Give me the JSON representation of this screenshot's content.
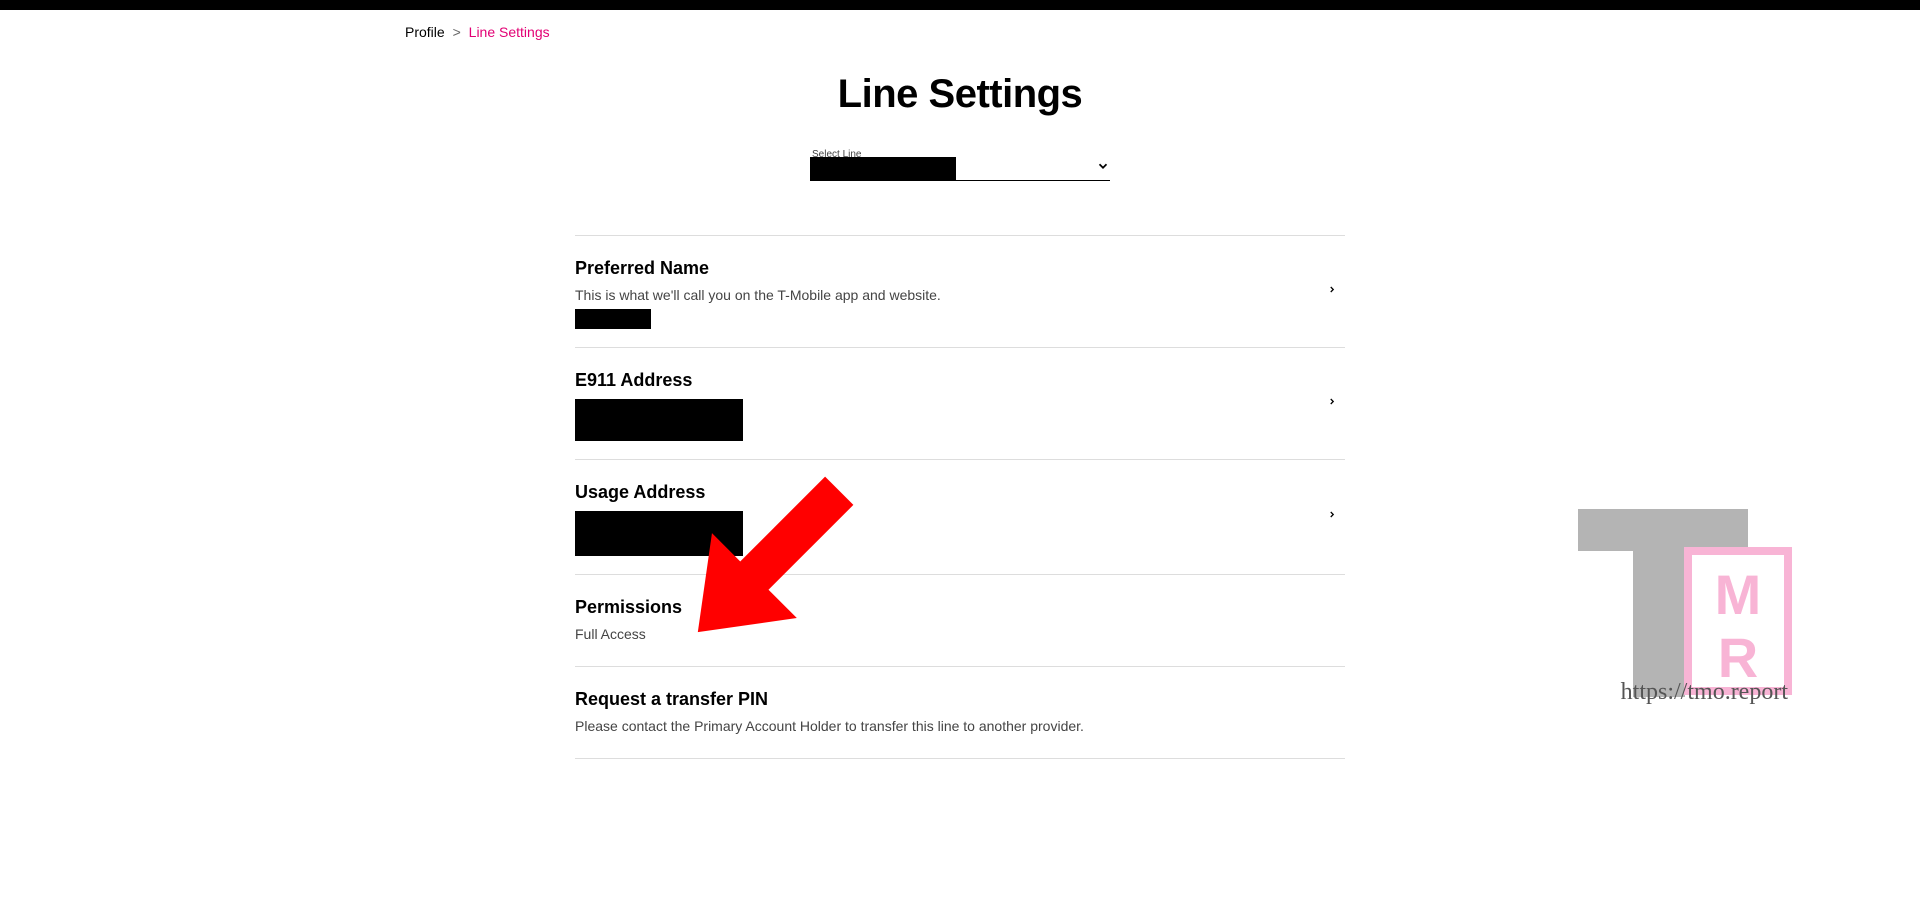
{
  "breadcrumb": {
    "root": "Profile",
    "current": "Line Settings"
  },
  "page_title": "Line Settings",
  "line_selector": {
    "label": "Select Line"
  },
  "rows": {
    "preferred_name": {
      "title": "Preferred Name",
      "desc": "This is what we'll call you on the T-Mobile app and website."
    },
    "e911": {
      "title": "E911 Address"
    },
    "usage": {
      "title": "Usage Address"
    },
    "permissions": {
      "title": "Permissions",
      "value": "Full Access"
    },
    "transfer_pin": {
      "title": "Request a transfer PIN",
      "desc": "Please contact the Primary Account Holder to transfer this line to another provider."
    }
  },
  "watermark_url": "https://tmo.report"
}
